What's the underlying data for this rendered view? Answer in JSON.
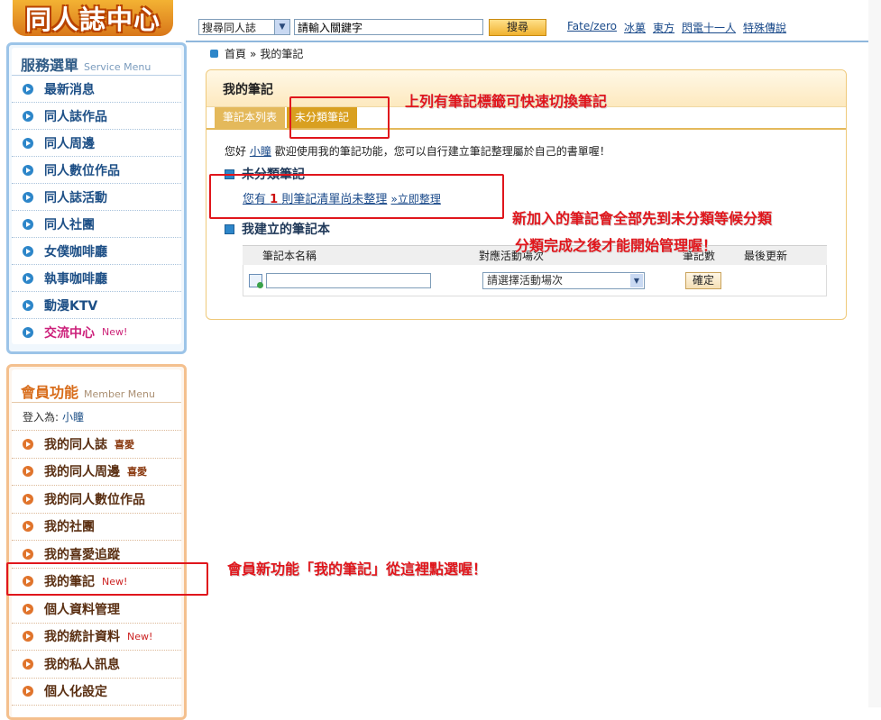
{
  "header": {
    "logo_text": "同人誌中心",
    "search_scope": "搜尋同人誌",
    "search_placeholder": "請輸入關鍵字",
    "search_button": "搜尋",
    "hot_links": [
      "Fate/zero",
      "冰菓",
      "東方",
      "閃電十一人",
      "特殊傳說"
    ]
  },
  "service_menu": {
    "title": "服務選單",
    "subtitle": "Service Menu",
    "items": [
      {
        "label": "最新消息"
      },
      {
        "label": "同人誌作品"
      },
      {
        "label": "同人周邊"
      },
      {
        "label": "同人數位作品"
      },
      {
        "label": "同人誌活動"
      },
      {
        "label": "同人社團"
      },
      {
        "label": "女僕咖啡廳"
      },
      {
        "label": "執事咖啡廳"
      },
      {
        "label": "動漫KTV"
      },
      {
        "label": "交流中心",
        "badge": "New!"
      }
    ]
  },
  "member_menu": {
    "title": "會員功能",
    "subtitle": "Member Menu",
    "login_label": "登入為:",
    "username": "小瞳",
    "items": [
      {
        "label": "我的同人誌",
        "tag": "喜愛"
      },
      {
        "label": "我的同人周邊",
        "tag": "喜愛"
      },
      {
        "label": "我的同人數位作品"
      },
      {
        "label": "我的社團"
      },
      {
        "label": "我的喜愛追蹤"
      },
      {
        "label": "我的筆記",
        "badge": "New!"
      },
      {
        "label": "個人資料管理"
      },
      {
        "label": "我的統計資料",
        "badge": "New!"
      },
      {
        "label": "我的私人訊息"
      },
      {
        "label": "個人化設定"
      }
    ]
  },
  "breadcrumb": {
    "home": "首頁",
    "sep": "»",
    "current": "我的筆記"
  },
  "panel": {
    "title": "我的筆記",
    "tabs": [
      "筆記本列表",
      "未分類筆記"
    ],
    "welcome_prefix": "您好",
    "welcome_user": "小瞳",
    "welcome_text": "歡迎使用我的筆記功能，您可以自行建立筆記整理屬於自己的書單喔！",
    "uncat_title": "未分類筆記",
    "pending_prefix": "您有",
    "pending_count": "1",
    "pending_suffix": "則筆記清單尚未整理",
    "pending_action": "»立即整理",
    "mynb_title": "我建立的筆記本",
    "table_headers": [
      "筆記本名稱",
      "對應活動場次",
      "筆記數",
      "最後更新"
    ],
    "event_select": "請選擇活動場次",
    "confirm_button": "確定"
  },
  "annotations": {
    "tab_note": "上列有筆記標籤可快速切換筆記",
    "uncat_note_1": "新加入的筆記會全部先到未分類等候分類",
    "uncat_note_2": "分類完成之後才能開始管理喔！",
    "menu_note": "會員新功能「我的筆記」從這裡點選喔！"
  }
}
